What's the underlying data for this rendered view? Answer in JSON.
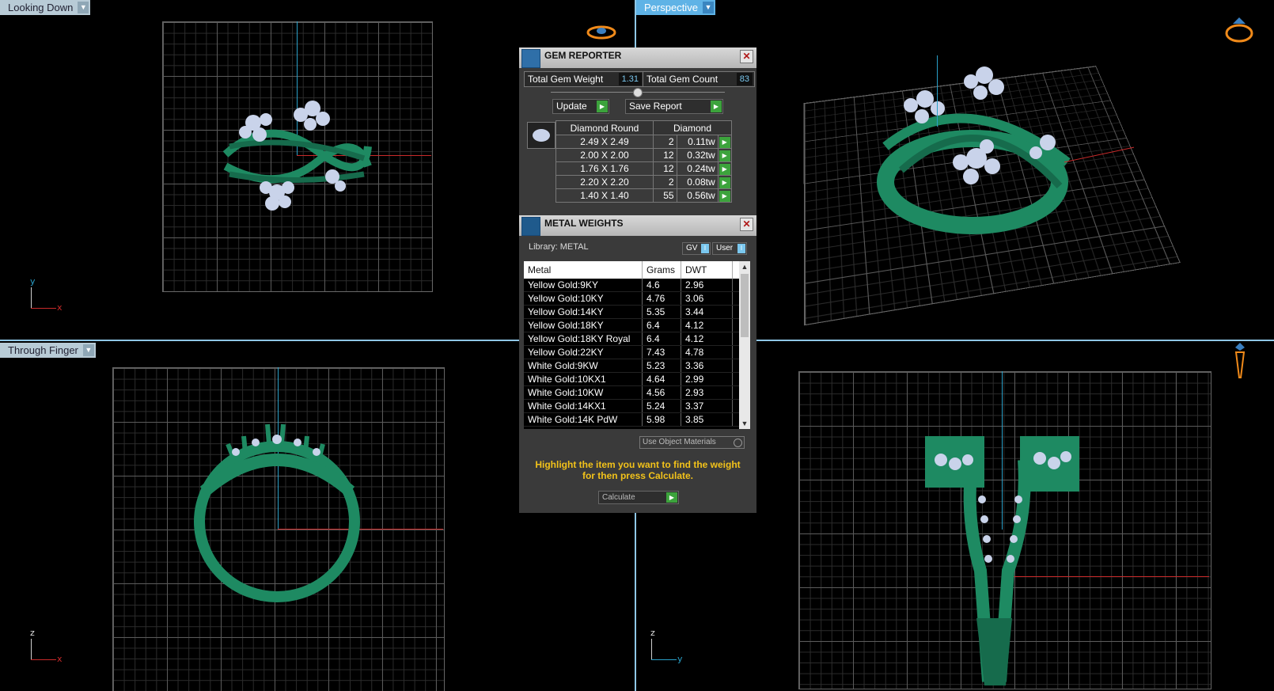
{
  "viewports": {
    "top_left": {
      "label": "Looking Down",
      "axis1": "y",
      "axis2": "x"
    },
    "top_right": {
      "label": "Perspective"
    },
    "bottom_left": {
      "label": "Through Finger",
      "axis1": "z",
      "axis2": "x"
    },
    "bottom_right": {
      "axis1": "z",
      "axis2": "y"
    }
  },
  "gem_reporter": {
    "title": "GEM REPORTER",
    "total_gem_weight_label": "Total Gem Weight",
    "total_gem_weight": "1.31",
    "total_gem_count_label": "Total Gem Count",
    "total_gem_count": "83",
    "update_label": "Update",
    "save_report_label": "Save Report",
    "col_shape": "Diamond Round",
    "col_material": "Diamond",
    "rows": [
      {
        "size": "2.49 X 2.49",
        "count": "2",
        "weight": "0.11tw"
      },
      {
        "size": "2.00 X 2.00",
        "count": "12",
        "weight": "0.32tw"
      },
      {
        "size": "1.76 X 1.76",
        "count": "12",
        "weight": "0.24tw"
      },
      {
        "size": "2.20 X 2.20",
        "count": "2",
        "weight": "0.08tw"
      },
      {
        "size": "1.40 X 1.40",
        "count": "55",
        "weight": "0.56tw"
      }
    ]
  },
  "metal_weights": {
    "title": "METAL WEIGHTS",
    "library": "Library: METAL",
    "gv_label": "GV",
    "user_label": "User",
    "col_metal": "Metal",
    "col_grams": "Grams",
    "col_dwt": "DWT",
    "rows": [
      {
        "metal": "Yellow Gold:9KY",
        "grams": "4.6",
        "dwt": "2.96"
      },
      {
        "metal": "Yellow Gold:10KY",
        "grams": "4.76",
        "dwt": "3.06"
      },
      {
        "metal": "Yellow Gold:14KY",
        "grams": "5.35",
        "dwt": "3.44"
      },
      {
        "metal": "Yellow Gold:18KY",
        "grams": "6.4",
        "dwt": "4.12"
      },
      {
        "metal": "Yellow Gold:18KY Royal",
        "grams": "6.4",
        "dwt": "4.12"
      },
      {
        "metal": "Yellow Gold:22KY",
        "grams": "7.43",
        "dwt": "4.78"
      },
      {
        "metal": "White Gold:9KW",
        "grams": "5.23",
        "dwt": "3.36"
      },
      {
        "metal": "White Gold:10KX1",
        "grams": "4.64",
        "dwt": "2.99"
      },
      {
        "metal": "White Gold:10KW",
        "grams": "4.56",
        "dwt": "2.93"
      },
      {
        "metal": "White Gold:14KX1",
        "grams": "5.24",
        "dwt": "3.37"
      },
      {
        "metal": "White Gold:14K PdW",
        "grams": "5.98",
        "dwt": "3.85"
      }
    ],
    "use_object_materials": "Use Object Materials",
    "hint": "Highlight the item you want to find the weight for then press Calculate.",
    "calculate_label": "Calculate"
  },
  "colors": {
    "accent": "#5fb3e6",
    "model": "#1e8a62",
    "gem": "#c9d3ea",
    "hint": "#f2c21a"
  }
}
